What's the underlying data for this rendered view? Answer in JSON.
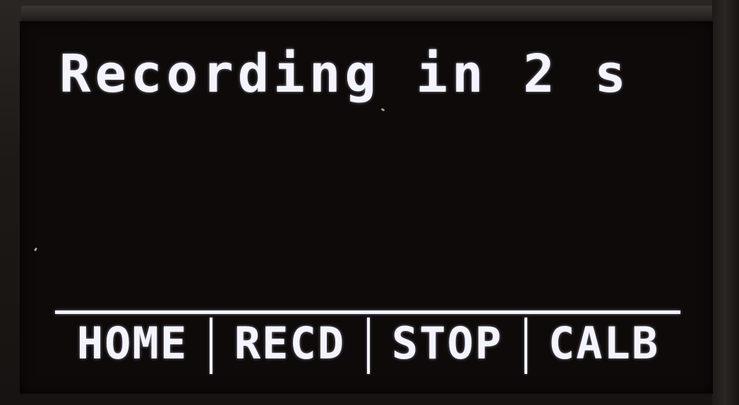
{
  "screen": {
    "status_text": "Recording in 2 s"
  },
  "menu": {
    "items": [
      {
        "label": "HOME"
      },
      {
        "label": "RECD"
      },
      {
        "label": "STOP"
      },
      {
        "label": "CALB"
      }
    ]
  },
  "colors": {
    "pixel_on": "#f4f4ff",
    "screen_background": "#0e0a09",
    "bezel": "#2a2624"
  }
}
